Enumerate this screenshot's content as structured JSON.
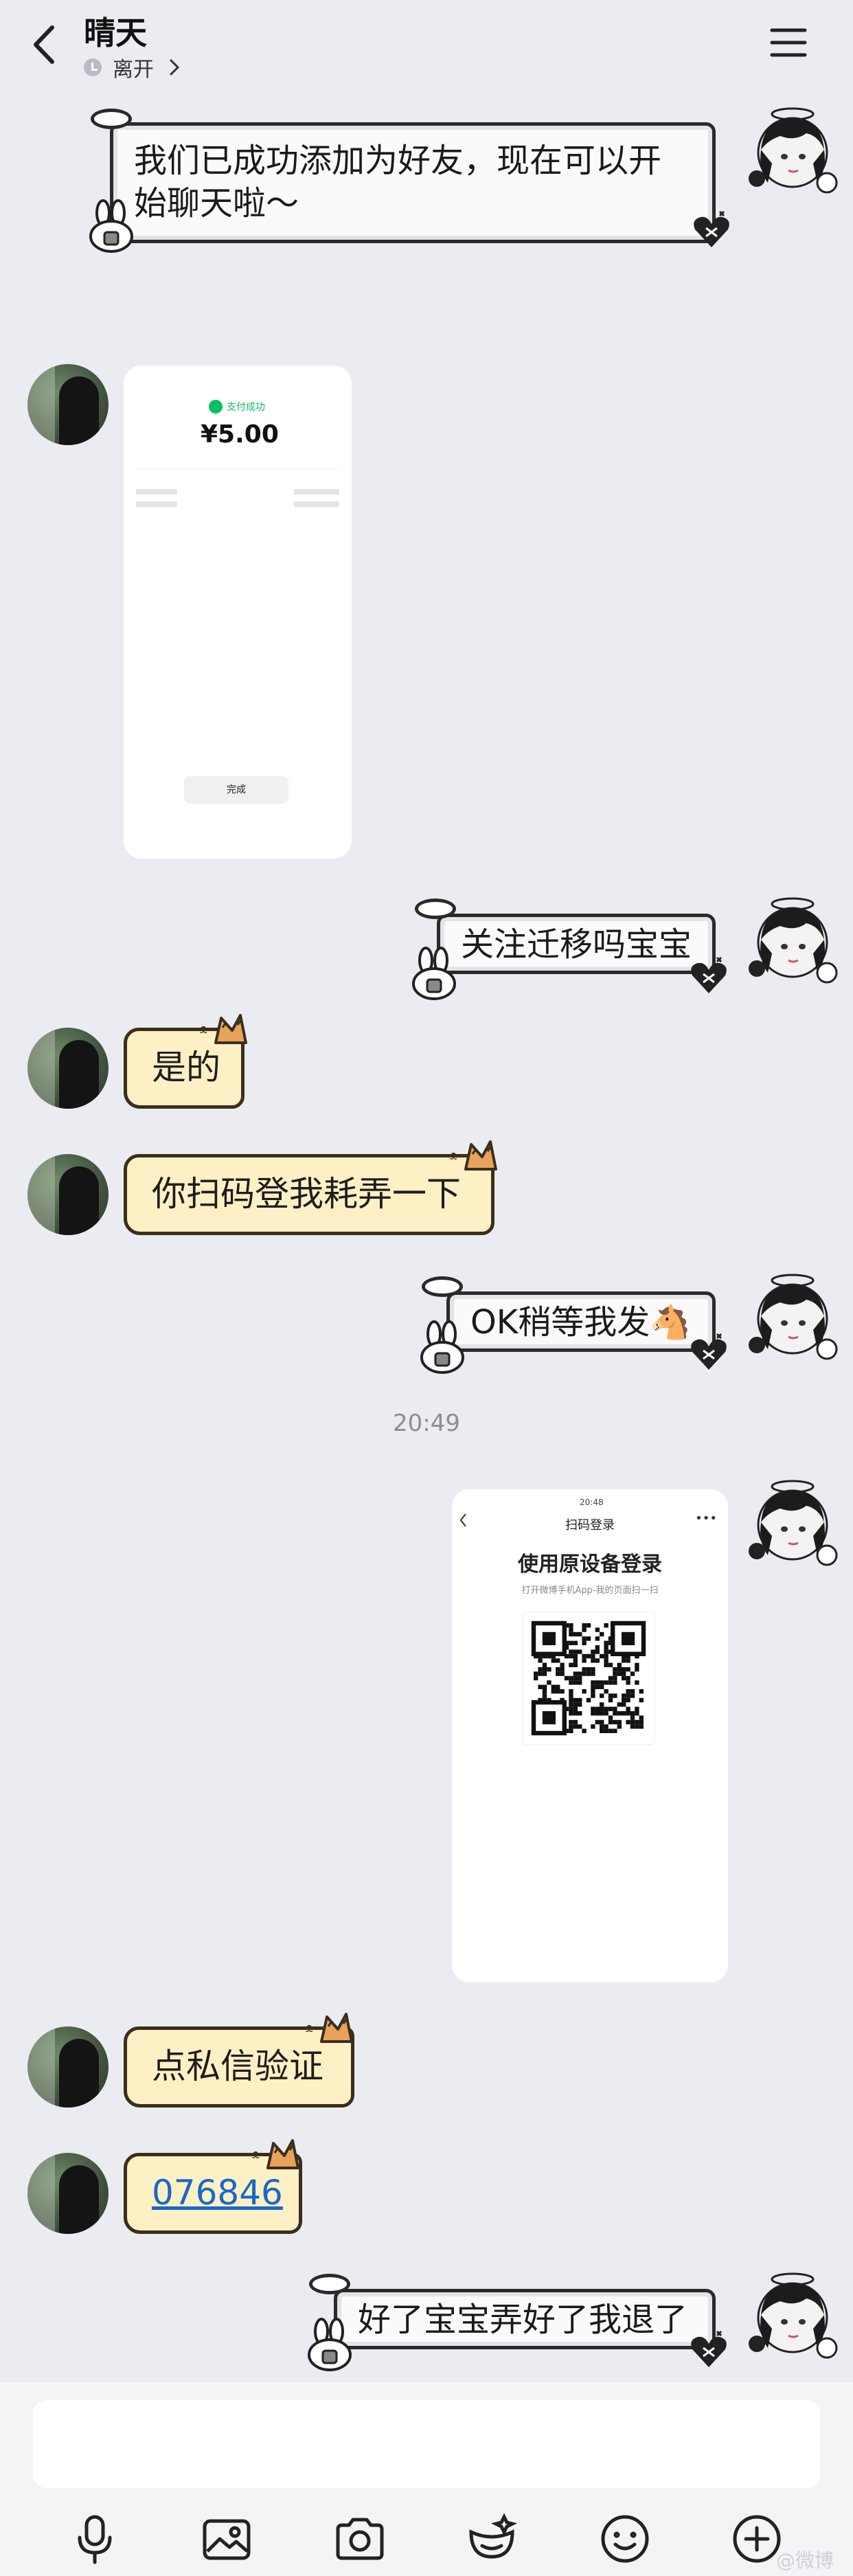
{
  "header": {
    "title": "晴天",
    "status": "离开"
  },
  "messages": {
    "system_friend": "我们已成功添加为好友，现在可以开始聊天啦～",
    "m1": "关注迁移吗宝宝",
    "m2": "是的",
    "m3": "你扫码登我耗弄一下",
    "m4": "OK稍等我发🐴",
    "timestamp": "20:49",
    "m5": "点私信验证",
    "m6": "076846",
    "m7": "好了宝宝弄好了我退了"
  },
  "payment_screenshot": {
    "status_success": "支付成功",
    "amount": "¥5.00",
    "done_button": "完成"
  },
  "qr_screenshot": {
    "time": "20:48",
    "page_title": "扫码登录",
    "heading": "使用原设备登录",
    "subtitle": "打开微博手机App-我的页面扫一扫"
  },
  "input": {
    "placeholder": ""
  },
  "watermark": "@微博",
  "colors": {
    "background": "#ebecf1",
    "self_bubble": "#fafafb",
    "other_bubble": "#fdf0c4",
    "link": "#1967c9",
    "pay_green": "#07c160"
  },
  "icons": {
    "toolbar": [
      "microphone-icon",
      "image-icon",
      "camera-icon",
      "sticker-icon",
      "emoji-icon",
      "plus-icon"
    ]
  }
}
